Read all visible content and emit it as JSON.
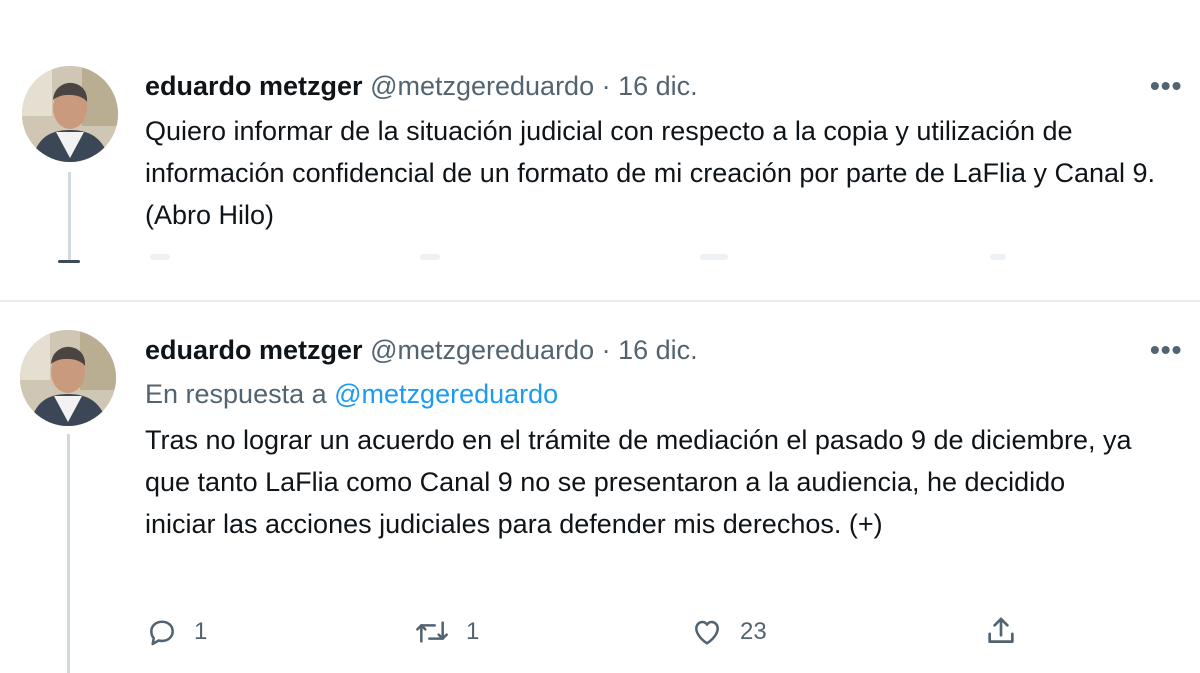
{
  "tweets": [
    {
      "author_name": "eduardo metzger",
      "author_handle": "@metzgereduardo",
      "separator": "·",
      "date": "16 dic.",
      "more_label": "•••",
      "body": "Quiero informar de la situación judicial con respecto a la copia y utilización de información confidencial de un formato de mi creación por parte de LaFlia y Canal 9. (Abro Hilo)"
    },
    {
      "author_name": "eduardo metzger",
      "author_handle": "@metzgereduardo",
      "separator": "·",
      "date": "16 dic.",
      "more_label": "•••",
      "reply_prefix": "En respuesta a",
      "reply_mention": "@metzgereduardo",
      "body": "Tras no lograr un acuerdo en el trámite de mediación el pasado 9 de diciembre, ya que tanto LaFlia como Canal 9 no se presentaron a la audiencia, he decidido iniciar las acciones judiciales para defender mis derechos. (+)",
      "actions": {
        "reply": {
          "icon": "reply-icon",
          "count": "1"
        },
        "retweet": {
          "icon": "retweet-icon",
          "count": "1"
        },
        "like": {
          "icon": "heart-icon",
          "count": "23"
        },
        "share": {
          "icon": "share-icon"
        }
      }
    }
  ],
  "colors": {
    "text_primary": "#0f1419",
    "text_secondary": "#536471",
    "link": "#1d9bf0",
    "divider": "#e9ecee"
  }
}
